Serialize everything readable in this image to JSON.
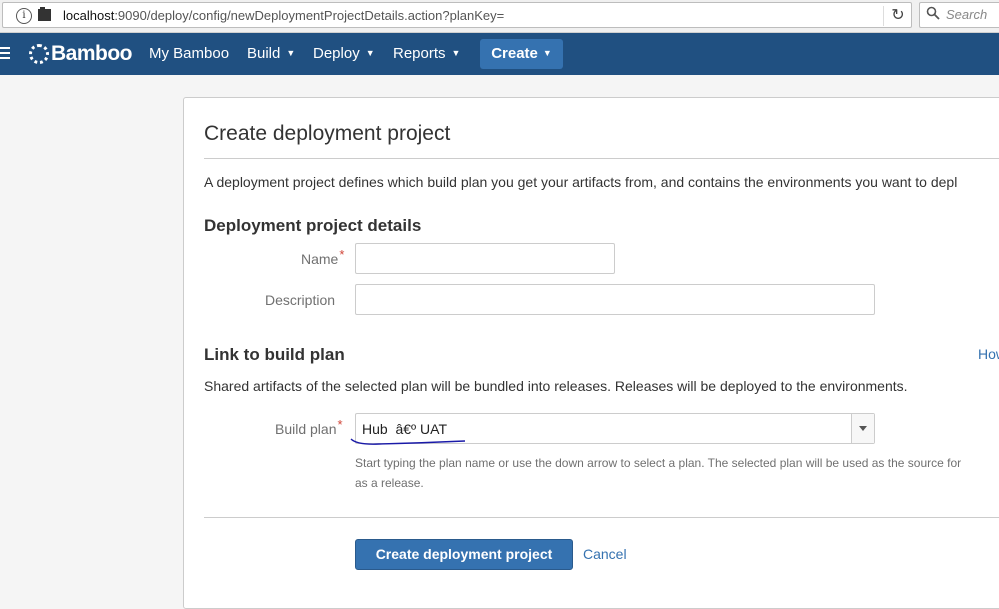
{
  "browser": {
    "url_host": "localhost",
    "url_rest": ":9090/deploy/config/newDeploymentProjectDetails.action?planKey=",
    "search_placeholder": "Search",
    "info_glyph": "i",
    "reload_glyph": "↻",
    "search_glyph": "🔍"
  },
  "header": {
    "logo_text": "Bamboo",
    "nav": {
      "my_bamboo": "My Bamboo",
      "build": "Build",
      "deploy": "Deploy",
      "reports": "Reports",
      "create": "Create"
    },
    "caret": "▼",
    "colors": {
      "bar": "#205081",
      "create_button": "#3572b0"
    }
  },
  "page": {
    "title": "Create deployment project",
    "intro": "A deployment project defines which build plan you get your artifacts from, and contains the environments you want to depl",
    "details_heading": "Deployment project details",
    "name_label": "Name",
    "description_label": "Description",
    "required_mark": "*",
    "name_value": "",
    "description_value": "",
    "link_heading": "Link to build plan",
    "how_link": "How",
    "shared_desc": "Shared artifacts of the selected plan will be bundled into releases. Releases will be deployed to the environments.",
    "build_plan_label": "Build plan",
    "build_plan_value": "Hub  â€º UAT",
    "help_line1": "Start typing the plan name or use the down arrow to select a plan. The selected plan will be used as the source for",
    "help_line2": "as a release.",
    "submit_label": "Create deployment project",
    "cancel_label": "Cancel",
    "link_color": "#3572b0"
  }
}
